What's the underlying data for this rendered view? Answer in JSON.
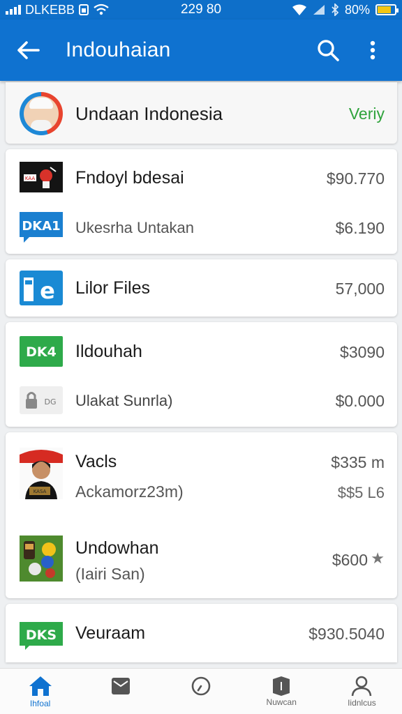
{
  "status_bar": {
    "carrier": "DLKEBB",
    "time": "229 80",
    "battery": "80%",
    "battery_level": 0.8
  },
  "app_bar": {
    "title": "Indouhaian",
    "back_icon": "arrow-left-icon",
    "search_icon": "search-icon",
    "menu_icon": "more-vert-icon"
  },
  "profile": {
    "name": "Undaan Indonesia",
    "status": "Veriy"
  },
  "cards": [
    {
      "rows": [
        {
          "primary": "Fndoyl bdesai",
          "amount": "$90.770",
          "thumb_text": "KAA"
        },
        {
          "primary": "Ukesrha Untakan",
          "amount": "$6.190",
          "thumb_text": "DKA1"
        }
      ]
    },
    {
      "rows": [
        {
          "primary": "Lilor Files",
          "amount": "57,000",
          "thumb_text": "e"
        }
      ]
    },
    {
      "rows": [
        {
          "primary": "Ildouhah",
          "amount": "$3090",
          "thumb_text": "DK4"
        },
        {
          "primary": "Ulakat Sunrla)",
          "amount": "$0.000",
          "thumb_text": "DG"
        }
      ]
    },
    {
      "rows": [
        {
          "primary": "Vacls",
          "secondary": "Ackamorz23m)",
          "amount": "$335 m",
          "amount2": "$$5 L6",
          "thumb_text": "KASA"
        },
        {
          "primary": "Undowhan",
          "secondary": "(Iairi San)",
          "amount": "$600",
          "star": "★"
        }
      ]
    },
    {
      "rows": [
        {
          "primary": "Veuraam",
          "amount": "$930.5040",
          "thumb_text": "DKS"
        }
      ]
    }
  ],
  "bottom_nav": [
    {
      "label": "Ihfoal",
      "icon": "home-icon",
      "active": true
    },
    {
      "label": "",
      "icon": "mail-icon",
      "active": false
    },
    {
      "label": "",
      "icon": "clock-icon",
      "active": false
    },
    {
      "label": "Nuwcan",
      "icon": "book-icon",
      "active": false
    },
    {
      "label": "Iidnlcus",
      "icon": "person-icon",
      "active": false
    }
  ],
  "colors": {
    "primary": "#0f72d0",
    "verify_green": "#2fa33c",
    "tile_green": "#2eaa4a",
    "tile_blue": "#1a7fd0"
  }
}
